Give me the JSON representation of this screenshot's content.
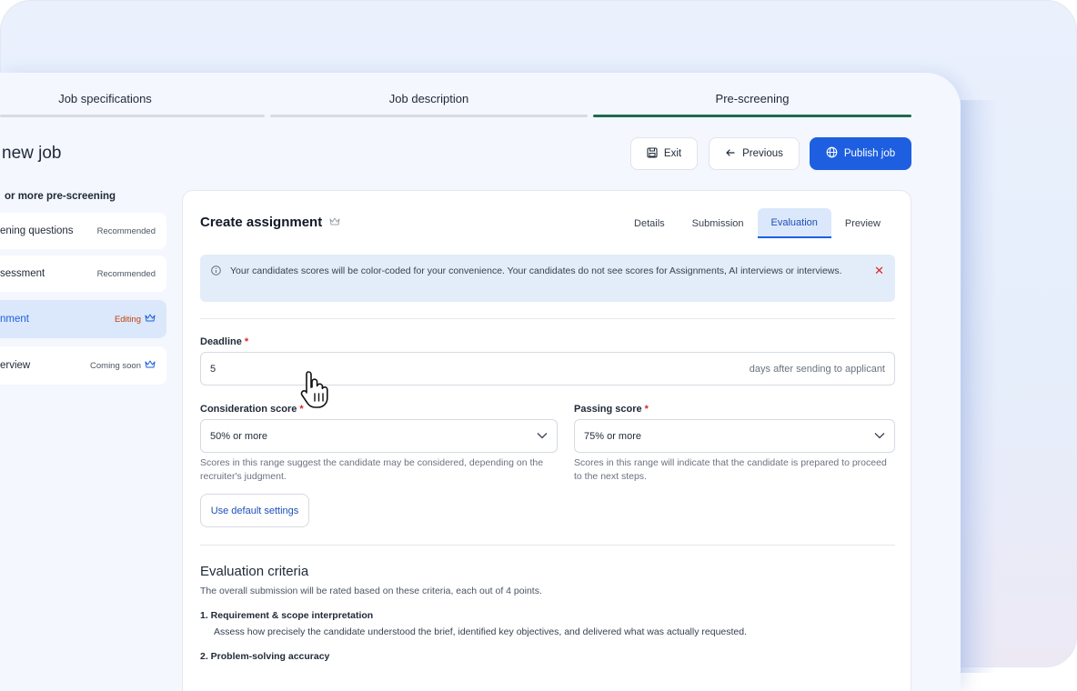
{
  "stepper": [
    {
      "label": "Job specifications",
      "active": false
    },
    {
      "label": "Job description",
      "active": false
    },
    {
      "label": "Pre-screening",
      "active": true
    }
  ],
  "page": {
    "title": "new job"
  },
  "header_buttons": {
    "exit": "Exit",
    "previous": "Previous",
    "publish": "Publish job"
  },
  "sidebar": {
    "heading": "or more pre-screening",
    "items": [
      {
        "label": "ening questions",
        "tag": "Recommended"
      },
      {
        "label": "sessment",
        "tag": "Recommended"
      },
      {
        "label": "nment",
        "tag": "Editing"
      },
      {
        "label": "erview",
        "tag": "Coming soon"
      }
    ]
  },
  "card": {
    "title": "Create assignment",
    "tabs": [
      "Details",
      "Submission",
      "Evaluation",
      "Preview"
    ],
    "active_tab": "Evaluation",
    "notice": "Your candidates scores will be color-coded for your convenience. Your candidates do not see scores for Assignments, AI interviews or interviews.",
    "deadline": {
      "label": "Deadline",
      "required": "*",
      "value": "5",
      "suffix": "days after sending to applicant"
    },
    "consideration": {
      "label": "Consideration score",
      "required": "*",
      "value": "50% or more",
      "help": "Scores in this range suggest the candidate may be considered, depending on the recruiter's judgment."
    },
    "passing": {
      "label": "Passing score",
      "required": "*",
      "value": "75% or more",
      "help": "Scores in this range will indicate that the candidate is prepared to proceed to the next steps."
    },
    "default_button": "Use default settings",
    "criteria": {
      "title": "Evaluation criteria",
      "subtitle": "The overall submission will be rated based on these criteria, each out of 4 points.",
      "items": [
        {
          "title": "1.  Requirement & scope interpretation",
          "desc": "Assess how precisely the candidate understood the brief, identified key objectives, and delivered what was actually requested."
        },
        {
          "title": "2.  Problem-solving accuracy",
          "desc": ""
        }
      ]
    }
  },
  "colors": {
    "primary": "#1d5fe0",
    "step_active": "#1d6b4f",
    "editing": "#c2410c",
    "required": "#dc2626"
  }
}
